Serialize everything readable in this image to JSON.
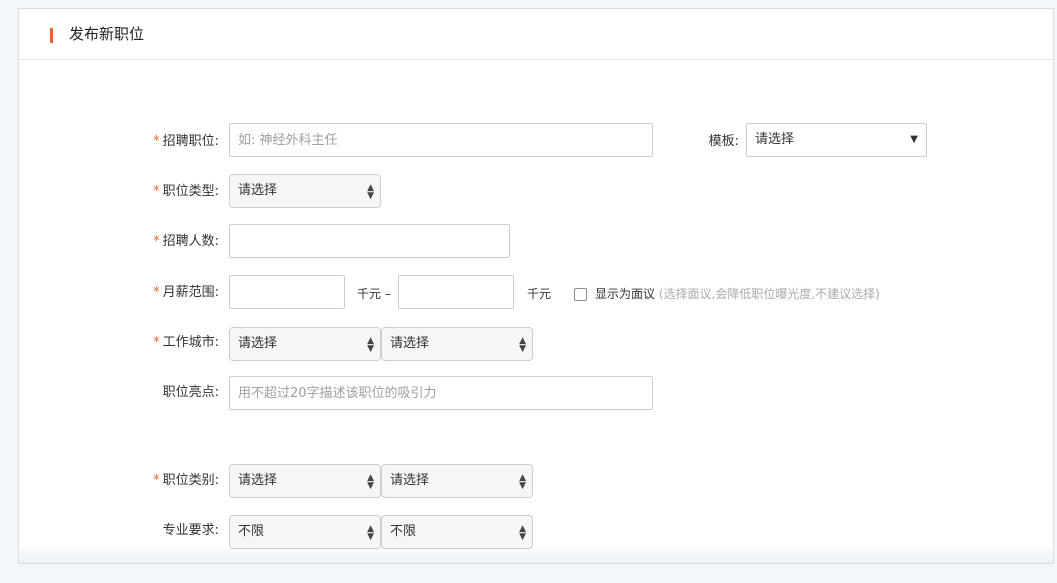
{
  "header": {
    "title": "发布新职位"
  },
  "form": {
    "position": {
      "label": "招聘职位:",
      "placeholder": "如: 神经外科主任"
    },
    "template": {
      "label": "模板:",
      "value": "请选择"
    },
    "position_type": {
      "label": "职位类型:",
      "value": "请选择"
    },
    "headcount": {
      "label": "招聘人数:",
      "value": ""
    },
    "salary": {
      "label": "月薪范围:",
      "unit_min": "千元 –",
      "unit_max": "千元",
      "negotiable_label": "显示为面议",
      "negotiable_hint": "(选择面议,会降低职位曝光度,不建议选择)",
      "negotiable_checked": false
    },
    "city": {
      "label": "工作城市:",
      "province": "请选择",
      "city": "请选择"
    },
    "highlight": {
      "label": "职位亮点:",
      "placeholder": "用不超过20字描述该职位的吸引力"
    },
    "category": {
      "label": "职位类别:",
      "primary": "请选择",
      "secondary": "请选择"
    },
    "major": {
      "label": "专业要求:",
      "primary": "不限",
      "secondary": "不限"
    },
    "required_mark": "*"
  },
  "colors": {
    "accent": "#e0682a",
    "border": "#c9ced4",
    "hint": "#a7adb3"
  }
}
